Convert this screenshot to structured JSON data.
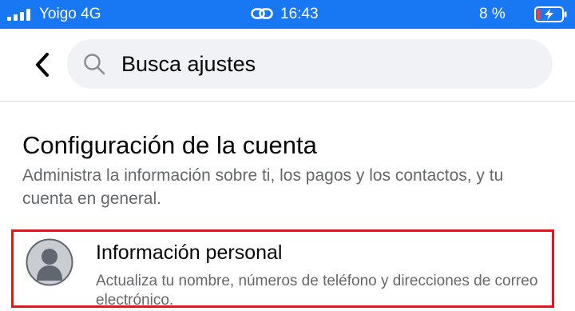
{
  "status_bar": {
    "carrier": "Yoigo",
    "network": "4G",
    "time": "16:43",
    "battery_percent": "8 %",
    "icons": [
      "signal-icon",
      "link-icon",
      "battery-charging-icon"
    ],
    "background_color": "#1877f2"
  },
  "search": {
    "back_icon": "back-chevron-icon",
    "search_icon": "search-icon",
    "placeholder": "Busca ajustes"
  },
  "section": {
    "title": "Configuración de la cuenta",
    "description": "Administra la información sobre ti, los pagos y los contactos, y tu cuenta en general."
  },
  "items": [
    {
      "icon": "personal-info-avatar-icon",
      "title": "Información personal",
      "description": "Actualiza tu nombre, números de teléfono y direcciones de correo electrónico.",
      "highlight_color": "#e8141b"
    }
  ]
}
